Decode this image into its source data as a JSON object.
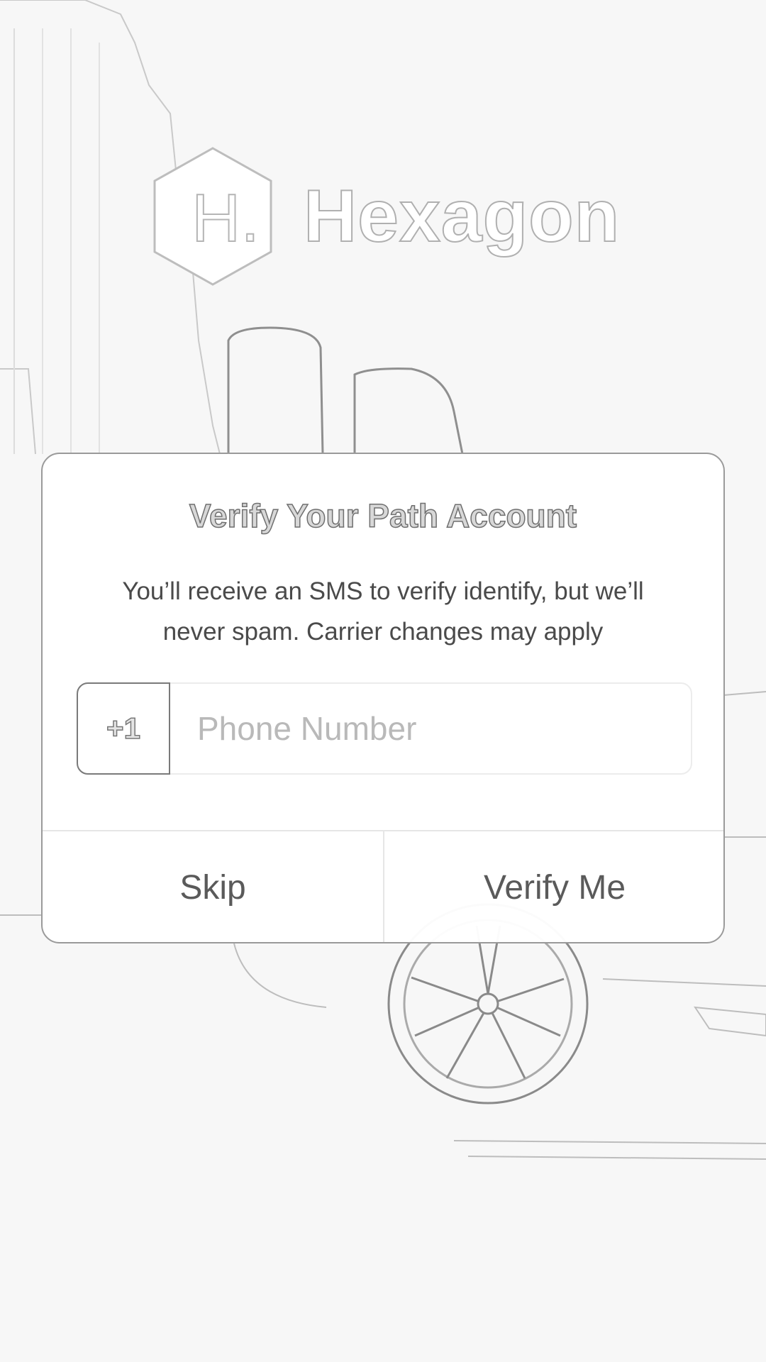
{
  "app": {
    "logo_letter": "H.",
    "logo_name": "Hexagon"
  },
  "dialog": {
    "title": "Verify Your Path Account",
    "message": "You’ll receive an SMS to verify identify, but we’ll never spam. Carrier changes may apply",
    "country_code": "+1",
    "phone_placeholder": "Phone Number",
    "phone_value": "",
    "skip_label": "Skip",
    "verify_label": "Verify Me"
  },
  "background": {
    "scene": "city-street-with-car-sketch",
    "icon": "hexagon-logo-icon"
  }
}
